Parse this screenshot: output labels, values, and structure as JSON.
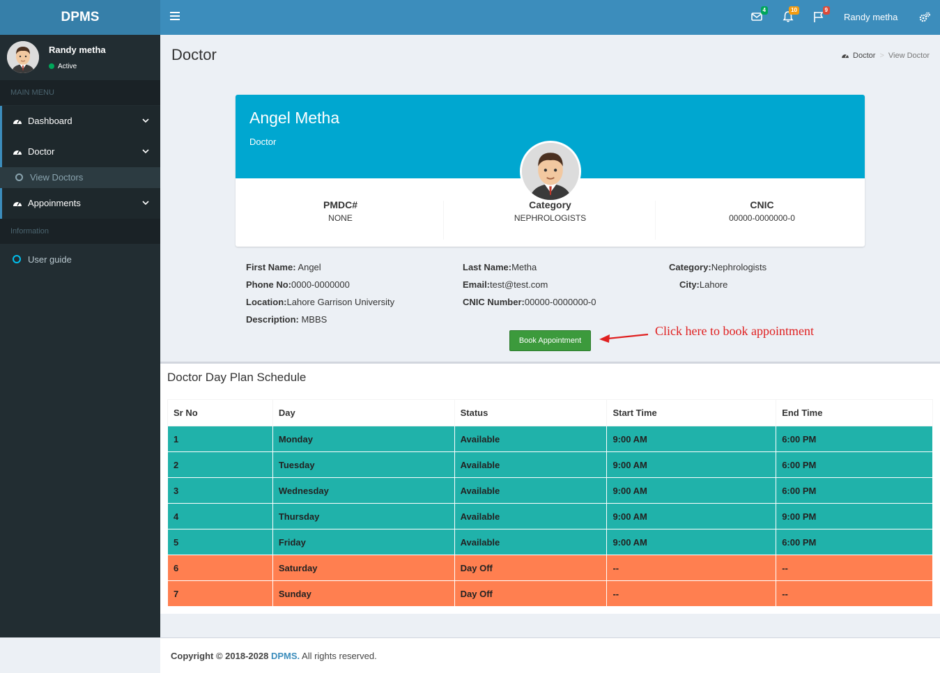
{
  "app": {
    "logo": "DPMS"
  },
  "navbar": {
    "badges": {
      "mail": "4",
      "bell": "10",
      "flag": "9"
    },
    "colors": {
      "mail": "#00a65a",
      "bell": "#f39c12",
      "flag": "#dd4b39"
    },
    "user_name": "Randy metha"
  },
  "sidebar": {
    "user": {
      "name": "Randy metha",
      "status": "Active"
    },
    "header_main": "MAIN MENU",
    "items": [
      {
        "label": "Dashboard"
      },
      {
        "label": "Doctor"
      },
      {
        "label": "View Doctors"
      },
      {
        "label": "Appoinments"
      }
    ],
    "header_info": "Information",
    "guide": "User guide"
  },
  "content": {
    "title": "Doctor",
    "breadcrumb": {
      "root": "Doctor",
      "sep": ">",
      "current": "View Doctor"
    }
  },
  "profile": {
    "name": "Angel Metha",
    "role": "Doctor",
    "stats": [
      {
        "label": "PMDC#",
        "value": "NONE"
      },
      {
        "label": "Category",
        "value": "NEPHROLOGISTS"
      },
      {
        "label": "CNIC",
        "value": "00000-0000000-0"
      }
    ],
    "details": {
      "first_name_label": "First Name:",
      "first_name": " Angel",
      "phone_label": "Phone No:",
      "phone": "0000-0000000",
      "location_label": "Location:",
      "location": "Lahore Garrison University",
      "description_label": "Description:",
      "description": " MBBS",
      "last_name_label": "Last Name:",
      "last_name": "Metha",
      "email_label": "Email:",
      "email": "test@test.com",
      "cnic_label": "CNIC Number:",
      "cnic": "00000-0000000-0",
      "category_label": "Category:",
      "category": "Nephrologists",
      "city_label": "City:",
      "city": "Lahore"
    },
    "book_button": "Book Appointment",
    "annotation": "Click here to book appointment"
  },
  "schedule": {
    "title": "Doctor Day Plan Schedule",
    "columns": [
      "Sr No",
      "Day",
      "Status",
      "Start Time",
      "End Time"
    ],
    "rows": [
      {
        "sr": "1",
        "day": "Monday",
        "status": "Available",
        "start": "9:00 AM",
        "end": "6:00 PM"
      },
      {
        "sr": "2",
        "day": "Tuesday",
        "status": "Available",
        "start": "9:00 AM",
        "end": "6:00 PM"
      },
      {
        "sr": "3",
        "day": "Wednesday",
        "status": "Available",
        "start": "9:00 AM",
        "end": "6:00 PM"
      },
      {
        "sr": "4",
        "day": "Thursday",
        "status": "Available",
        "start": "9:00 AM",
        "end": "9:00 PM"
      },
      {
        "sr": "5",
        "day": "Friday",
        "status": "Available",
        "start": "9:00 AM",
        "end": "6:00 PM"
      },
      {
        "sr": "6",
        "day": "Saturday",
        "status": "Day Off",
        "start": "--",
        "end": "--"
      },
      {
        "sr": "7",
        "day": "Sunday",
        "status": "Day Off",
        "start": "--",
        "end": "--"
      }
    ],
    "colors": {
      "available": "#20b2aa",
      "off": "#ff7f50"
    }
  },
  "footer": {
    "prefix": "Copyright © 2018-2028 ",
    "brand": "DPMS.",
    "suffix": " All rights reserved."
  }
}
